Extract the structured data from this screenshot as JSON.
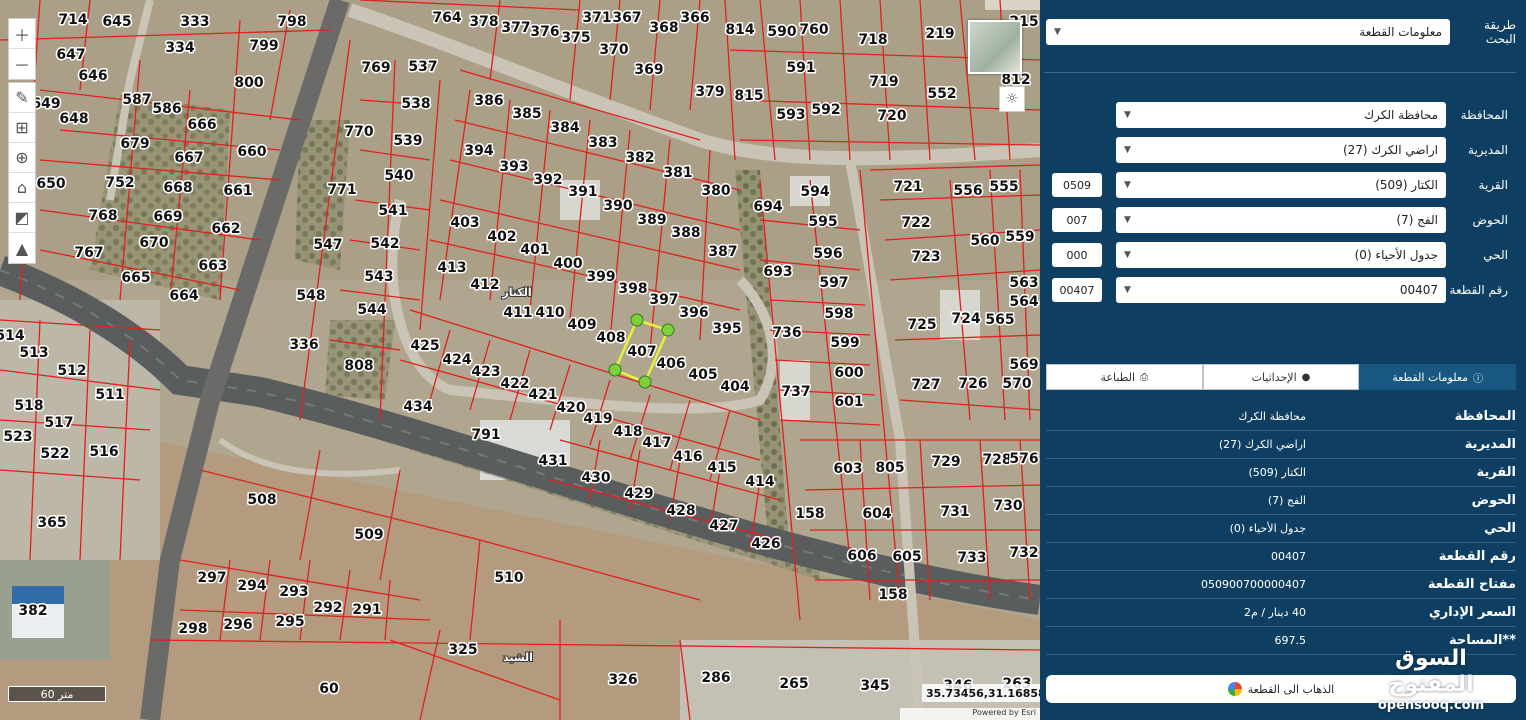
{
  "map": {
    "parcels": [
      [
        "714",
        73,
        20
      ],
      [
        "645",
        117,
        22
      ],
      [
        "333",
        195,
        22
      ],
      [
        "798",
        292,
        22
      ],
      [
        "764",
        447,
        18
      ],
      [
        "378",
        484,
        22
      ],
      [
        "377",
        516,
        28
      ],
      [
        "376",
        545,
        32
      ],
      [
        "375",
        576,
        38
      ],
      [
        "371",
        597,
        18
      ],
      [
        "367",
        627,
        18
      ],
      [
        "366",
        695,
        18
      ],
      [
        "814",
        740,
        30
      ],
      [
        "590",
        782,
        32
      ],
      [
        "760",
        814,
        30
      ],
      [
        "718",
        873,
        40
      ],
      [
        "219",
        940,
        34
      ],
      [
        "215",
        1024,
        22
      ],
      [
        "647",
        71,
        55
      ],
      [
        "334",
        180,
        48
      ],
      [
        "799",
        264,
        46
      ],
      [
        "370",
        614,
        50
      ],
      [
        "368",
        664,
        28
      ],
      [
        "369",
        649,
        70
      ],
      [
        "591",
        801,
        68
      ],
      [
        "719",
        884,
        82
      ],
      [
        "552",
        942,
        94
      ],
      [
        "812",
        1016,
        80
      ],
      [
        "646",
        93,
        76
      ],
      [
        "769",
        376,
        68
      ],
      [
        "537",
        423,
        67
      ],
      [
        "800",
        249,
        83
      ],
      [
        "379",
        710,
        92
      ],
      [
        "815",
        749,
        96
      ],
      [
        "649",
        46,
        104
      ],
      [
        "587",
        137,
        100
      ],
      [
        "586",
        167,
        109
      ],
      [
        "538",
        416,
        104
      ],
      [
        "386",
        489,
        101
      ],
      [
        "385",
        527,
        114
      ],
      [
        "593",
        791,
        115
      ],
      [
        "592",
        826,
        110
      ],
      [
        "720",
        892,
        116
      ],
      [
        "648",
        74,
        119
      ],
      [
        "666",
        202,
        125
      ],
      [
        "384",
        565,
        128
      ],
      [
        "679",
        135,
        144
      ],
      [
        "770",
        359,
        132
      ],
      [
        "539",
        408,
        141
      ],
      [
        "383",
        603,
        143
      ],
      [
        "660",
        252,
        152
      ],
      [
        "667",
        189,
        158
      ],
      [
        "394",
        479,
        151
      ],
      [
        "382",
        640,
        158
      ],
      [
        "752",
        120,
        183
      ],
      [
        "668",
        178,
        188
      ],
      [
        "661",
        238,
        191
      ],
      [
        "650",
        51,
        184
      ],
      [
        "771",
        342,
        190
      ],
      [
        "540",
        399,
        176
      ],
      [
        "393",
        514,
        167
      ],
      [
        "392",
        548,
        180
      ],
      [
        "381",
        678,
        173
      ],
      [
        "391",
        583,
        192
      ],
      [
        "380",
        716,
        191
      ],
      [
        "594",
        815,
        192
      ],
      [
        "721",
        908,
        187
      ],
      [
        "556",
        968,
        191
      ],
      [
        "555",
        1004,
        187
      ],
      [
        "541",
        393,
        211
      ],
      [
        "390",
        618,
        206
      ],
      [
        "694",
        768,
        207
      ],
      [
        "768",
        103,
        216
      ],
      [
        "669",
        168,
        217
      ],
      [
        "662",
        226,
        229
      ],
      [
        "403",
        465,
        223
      ],
      [
        "402",
        502,
        237
      ],
      [
        "389",
        652,
        220
      ],
      [
        "388",
        686,
        233
      ],
      [
        "595",
        823,
        222
      ],
      [
        "722",
        916,
        223
      ],
      [
        "559",
        1020,
        237
      ],
      [
        "670",
        154,
        243
      ],
      [
        "547",
        328,
        245
      ],
      [
        "542",
        385,
        244
      ],
      [
        "401",
        535,
        250
      ],
      [
        "387",
        723,
        252
      ],
      [
        "560",
        985,
        241
      ],
      [
        "767",
        89,
        253
      ],
      [
        "663",
        213,
        266
      ],
      [
        "413",
        452,
        268
      ],
      [
        "400",
        568,
        264
      ],
      [
        "596",
        828,
        254
      ],
      [
        "723",
        926,
        257
      ],
      [
        "665",
        136,
        278
      ],
      [
        "399",
        601,
        277
      ],
      [
        "693",
        778,
        272
      ],
      [
        "563",
        1024,
        283
      ],
      [
        "664",
        184,
        296
      ],
      [
        "548",
        311,
        296
      ],
      [
        "543",
        379,
        277
      ],
      [
        "412",
        485,
        285
      ],
      [
        "398",
        633,
        289
      ],
      [
        "597",
        834,
        283
      ],
      [
        "564",
        1024,
        302
      ],
      [
        "544",
        372,
        310
      ],
      [
        "411",
        518,
        313
      ],
      [
        "410",
        550,
        313
      ],
      [
        "397",
        664,
        300
      ],
      [
        "396",
        694,
        313
      ],
      [
        "598",
        839,
        314
      ],
      [
        "724",
        966,
        319
      ],
      [
        "565",
        1000,
        320
      ],
      [
        "514",
        10,
        336
      ],
      [
        "409",
        582,
        325
      ],
      [
        "395",
        727,
        329
      ],
      [
        "736",
        787,
        333
      ],
      [
        "725",
        922,
        325
      ],
      [
        "513",
        34,
        353
      ],
      [
        "336",
        304,
        345
      ],
      [
        "408",
        611,
        338
      ],
      [
        "425",
        425,
        346
      ],
      [
        "599",
        845,
        343
      ],
      [
        "407",
        642,
        352
      ],
      [
        "424",
        457,
        360
      ],
      [
        "406",
        671,
        364
      ],
      [
        "808",
        359,
        366
      ],
      [
        "569",
        1024,
        365
      ],
      [
        "512",
        72,
        371
      ],
      [
        "423",
        486,
        372
      ],
      [
        "405",
        703,
        375
      ],
      [
        "600",
        849,
        373
      ],
      [
        "422",
        515,
        384
      ],
      [
        "404",
        735,
        387
      ],
      [
        "727",
        926,
        385
      ],
      [
        "726",
        973,
        384
      ],
      [
        "570",
        1017,
        384
      ],
      [
        "511",
        110,
        395
      ],
      [
        "421",
        543,
        395
      ],
      [
        "737",
        796,
        392
      ],
      [
        "601",
        849,
        402
      ],
      [
        "518",
        29,
        406
      ],
      [
        "434",
        418,
        407
      ],
      [
        "420",
        571,
        408
      ],
      [
        "517",
        59,
        423
      ],
      [
        "419",
        598,
        419
      ],
      [
        "523",
        18,
        437
      ],
      [
        "418",
        628,
        432
      ],
      [
        "791",
        486,
        435
      ],
      [
        "417",
        657,
        443
      ],
      [
        "522",
        55,
        454
      ],
      [
        "516",
        104,
        452
      ],
      [
        "416",
        688,
        457
      ],
      [
        "431",
        553,
        461
      ],
      [
        "603",
        848,
        469
      ],
      [
        "805",
        890,
        468
      ],
      [
        "729",
        946,
        462
      ],
      [
        "728",
        997,
        460
      ],
      [
        "576",
        1024,
        459
      ],
      [
        "415",
        722,
        468
      ],
      [
        "430",
        596,
        478
      ],
      [
        "414",
        760,
        482
      ],
      [
        "508",
        262,
        500
      ],
      [
        "429",
        639,
        494
      ],
      [
        "604",
        877,
        514
      ],
      [
        "731",
        955,
        512
      ],
      [
        "730",
        1008,
        506
      ],
      [
        "365",
        52,
        523
      ],
      [
        "428",
        681,
        511
      ],
      [
        "158",
        810,
        514
      ],
      [
        "509",
        369,
        535
      ],
      [
        "427",
        724,
        526
      ],
      [
        "426",
        766,
        544
      ],
      [
        "606",
        862,
        556
      ],
      [
        "605",
        907,
        557
      ],
      [
        "733",
        972,
        558
      ],
      [
        "732",
        1024,
        553
      ],
      [
        "510",
        509,
        578
      ],
      [
        "297",
        212,
        578
      ],
      [
        "294",
        252,
        586
      ],
      [
        "293",
        294,
        592
      ],
      [
        "158",
        893,
        595
      ],
      [
        "382",
        33,
        611
      ],
      [
        "292",
        328,
        608
      ],
      [
        "291",
        367,
        610
      ],
      [
        "298",
        193,
        629
      ],
      [
        "296",
        238,
        625
      ],
      [
        "295",
        290,
        622
      ],
      [
        "325",
        463,
        650
      ],
      [
        "326",
        623,
        680
      ],
      [
        "286",
        716,
        678
      ],
      [
        "265",
        794,
        684
      ],
      [
        "345",
        875,
        686
      ],
      [
        "346",
        958,
        686
      ],
      [
        "263",
        1017,
        684
      ],
      [
        "60",
        329,
        689
      ]
    ],
    "area_labels": [
      [
        "الكتار",
        517,
        296
      ],
      [
        "الشيد",
        518,
        661
      ]
    ],
    "scale": "60 متر",
    "coordinates": "35.73456,31.16858",
    "credit": "Powered by Esri"
  },
  "search": {
    "label": "طريقة البحث",
    "value": "معلومات القطعة"
  },
  "filters": [
    {
      "label": "المحافظة",
      "value": "محافظة الكرك",
      "code": ""
    },
    {
      "label": "المديرية",
      "value": "اراضي الكرك (27)",
      "code": ""
    },
    {
      "label": "القرية",
      "value": "الكتار (509)",
      "code": "0509"
    },
    {
      "label": "الحوض",
      "value": "الفج (7)",
      "code": "007"
    },
    {
      "label": "الحي",
      "value": "جدول الأحياء (0)",
      "code": "000"
    },
    {
      "label": "رقم القطعة",
      "value": "00407",
      "code": "00407"
    }
  ],
  "tabs": [
    {
      "label": "معلومات القطعة",
      "icon": "info-icon",
      "active": true
    },
    {
      "label": "الإحداثيات",
      "icon": "user-pin-icon",
      "active": false
    },
    {
      "label": "الطباعة",
      "icon": "print-icon",
      "active": false
    }
  ],
  "info": [
    {
      "key": "المحافظة",
      "value": "محافظة الكرك"
    },
    {
      "key": "المديرية",
      "value": "اراضي الكرك (27)"
    },
    {
      "key": "القرية",
      "value": "الكتار (509)"
    },
    {
      "key": "الحوض",
      "value": "الفج (7)"
    },
    {
      "key": "الحي",
      "value": "جدول الأحياء (0)"
    },
    {
      "key": "رقم القطعة",
      "value": "00407"
    },
    {
      "key": "مفتاح القطعة",
      "value": "050900700000407"
    },
    {
      "key": "السعر الإداري",
      "value": "40 دينار / م2"
    },
    {
      "key": "**المساحة",
      "value": "697.5"
    }
  ],
  "goto_button": "الذهاب الى القطعة",
  "watermark": {
    "arabic": "السوق المفتوح",
    "english": "opensooq.com"
  },
  "colors": {
    "panel": "#0e3f62",
    "parcel_lines": "#e0201d",
    "highlight": "#e8f03a",
    "accent": "#18577f"
  }
}
